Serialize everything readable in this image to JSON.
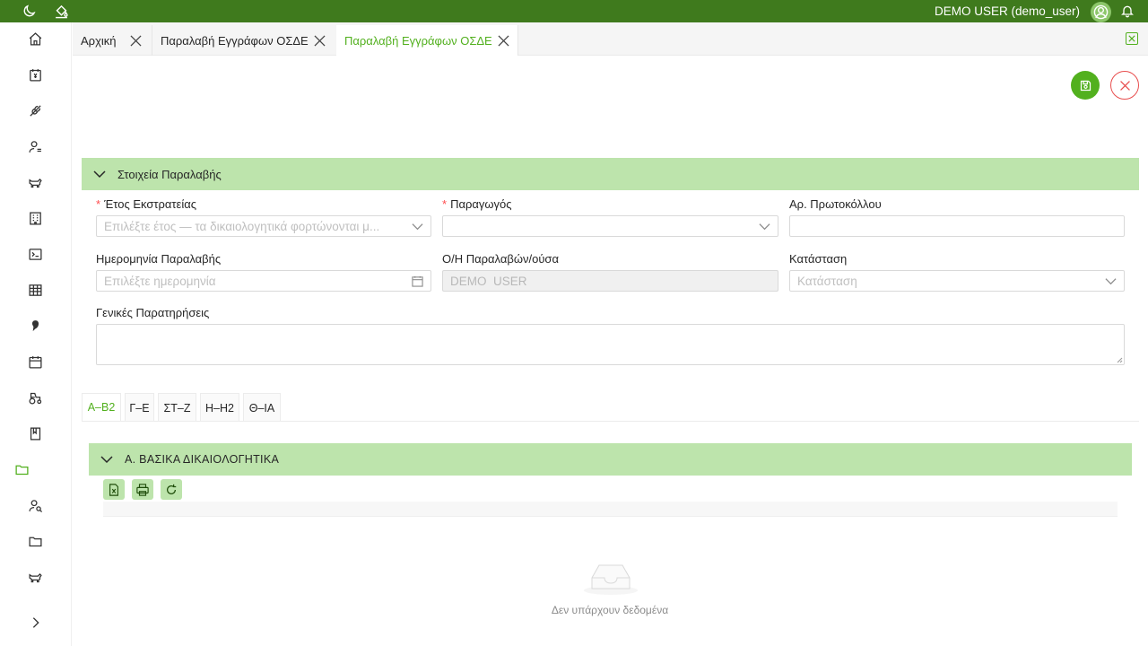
{
  "topbar": {
    "user_label": "DEMO USER (demo_user)",
    "icons": [
      "moon-icon",
      "paint-bucket-icon",
      "user-avatar-icon",
      "bell-icon"
    ]
  },
  "sidebar": {
    "items": [
      "home-icon",
      "calendar-money-icon",
      "seedling-icon",
      "user-list-icon",
      "cow-icon",
      "building-icon",
      "terminal-icon",
      "table-icon",
      "map-pin-icon",
      "calendar-icon",
      "tractor-icon",
      "book-icon",
      "folder-icon",
      "user-search-icon",
      "folder-icon",
      "cow-icon"
    ],
    "active_index": 12,
    "expand_icon": "chevron-right-icon"
  },
  "tabs": [
    {
      "label": "Αρχική",
      "active": false
    },
    {
      "label": "Παραλαβή Εγγράφων ΟΣΔΕ",
      "active": false
    },
    {
      "label": "Παραλαβή Εγγράφων ΟΣΔΕ",
      "active": true
    }
  ],
  "section": {
    "title": "Στοιχεία Παραλαβής"
  },
  "form": {
    "etos": {
      "label": "Έτος Εκστρατείας",
      "required": true,
      "placeholder": "Επιλέξτε έτος — τα δικαιολογητικά φορτώνονται μ..."
    },
    "paragogos": {
      "label": "Παραγωγός",
      "required": true,
      "value": ""
    },
    "protokollo": {
      "label": "Αρ. Πρωτοκόλλου",
      "value": ""
    },
    "imerominia": {
      "label": "Ημερομηνία Παραλαβής",
      "placeholder": "Επιλέξτε ημερομηνία"
    },
    "paralavon": {
      "label": "Ο/Η Παραλαβών/ούσα",
      "value": "DEMO  USER"
    },
    "katastasi": {
      "label": "Κατάσταση",
      "placeholder": "Κατάσταση"
    },
    "paratiriseis": {
      "label": "Γενικές Παρατηρήσεις",
      "value": ""
    }
  },
  "subtabs": [
    {
      "label": "Α–Β2",
      "active": true
    },
    {
      "label": "Γ–Ε",
      "active": false
    },
    {
      "label": "ΣΤ–Ζ",
      "active": false
    },
    {
      "label": "Η–Η2",
      "active": false
    },
    {
      "label": "Θ–ΙΑ",
      "active": false
    }
  ],
  "docs_section": {
    "title": "Α. ΒΑΣΙΚΑ ΔΙΚΑΙΟΛΟΓΗΤΙΚΑ",
    "toolbar": [
      "excel-export-icon",
      "print-icon",
      "refresh-icon"
    ],
    "empty_text": "Δεν υπάρχουν δεδομένα"
  },
  "colors": {
    "topbar": "#3f7a1d",
    "accent": "#52b01e",
    "section_bg": "#bde4ac",
    "danger": "#e84d4d"
  }
}
